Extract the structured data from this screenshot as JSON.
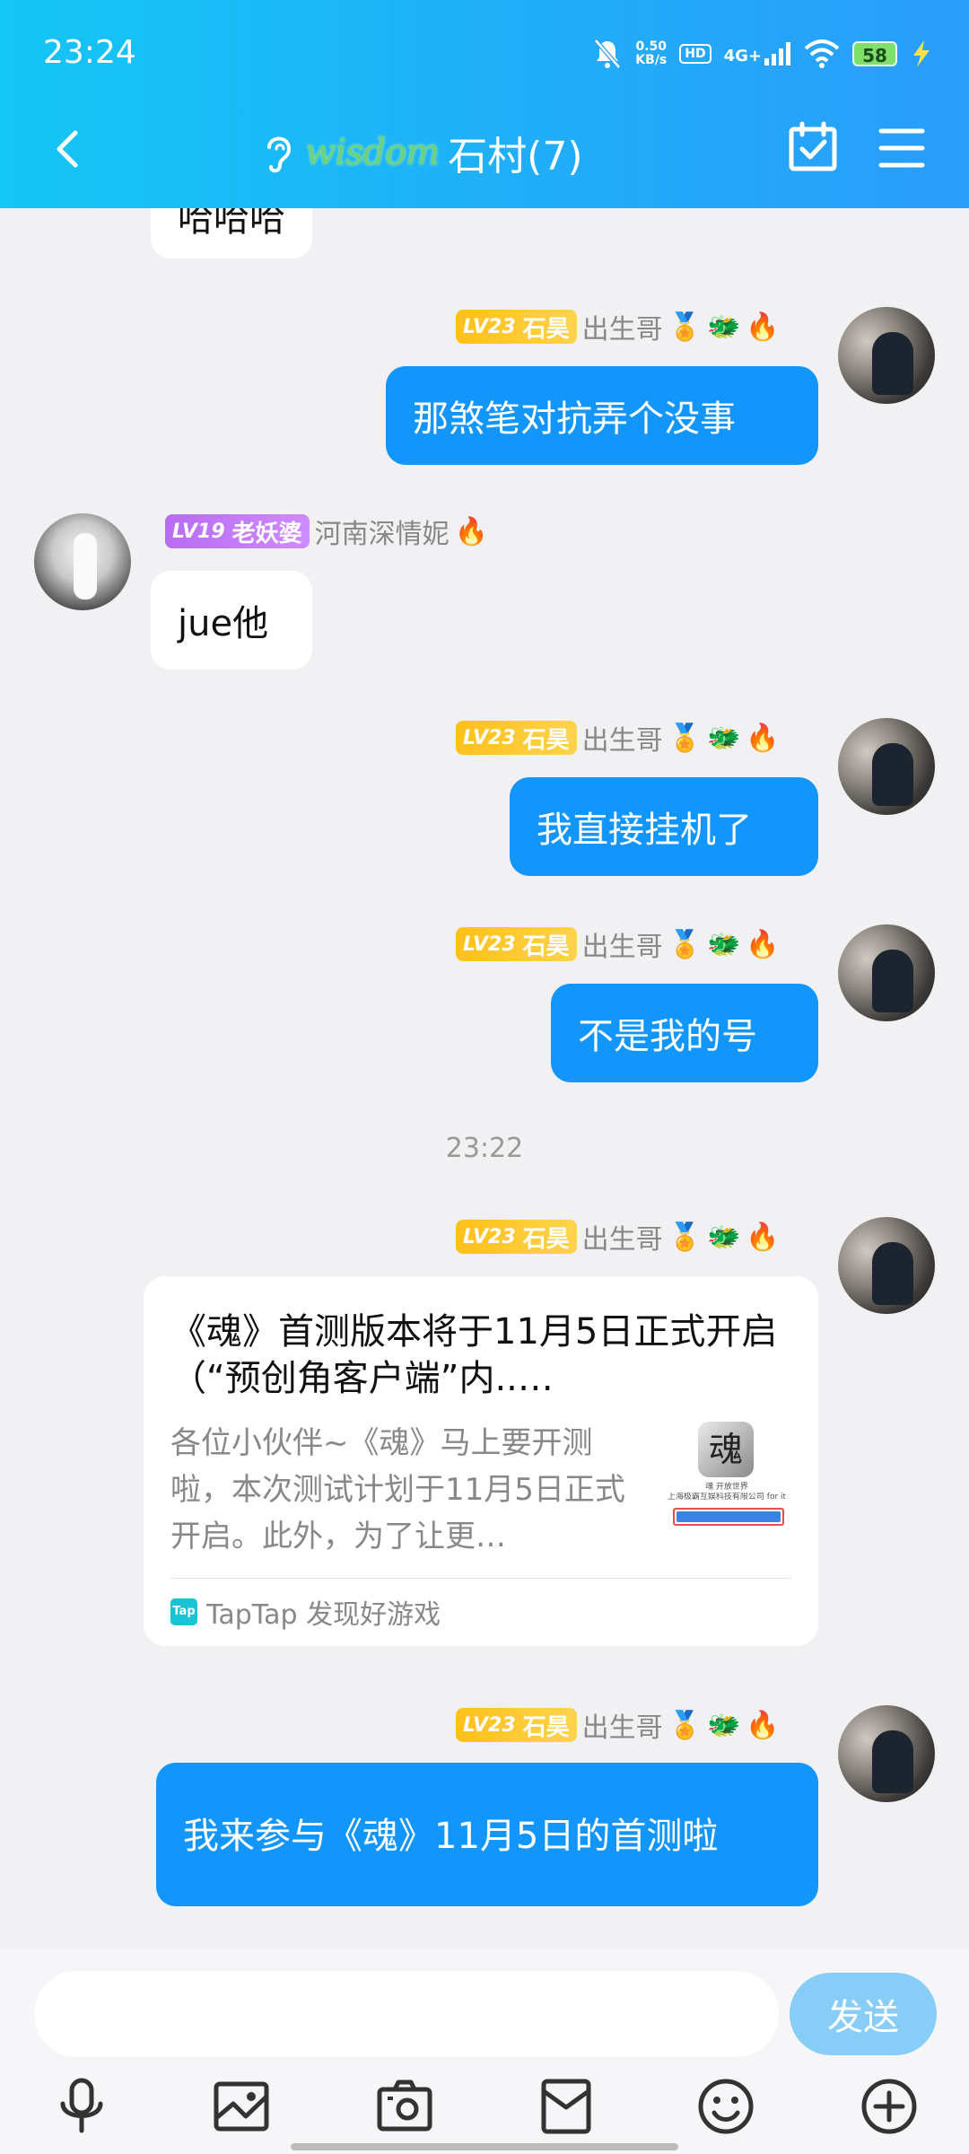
{
  "status_bar": {
    "time": "23:24",
    "net_speed_value": "0.50",
    "net_speed_unit": "KB/s",
    "hd_label": "HD",
    "network_label": "4G+",
    "battery_level": "58"
  },
  "header": {
    "wisdom_text": "wisdom",
    "group_title": "石村(7)"
  },
  "members": {
    "me": {
      "level": "LV23",
      "title": "石昊",
      "nick": "出生哥"
    },
    "other": {
      "level": "LV19",
      "title": "老妖婆",
      "nick": "河南深情妮"
    }
  },
  "messages": [
    {
      "text": "哈哈哈"
    },
    {
      "text": "那煞笔对抗弄个没事"
    },
    {
      "text": "jue他"
    },
    {
      "text": "我直接挂机了"
    },
    {
      "text": "不是我的号"
    },
    {
      "text": "我来参与《魂》11月5日的首测啦"
    }
  ],
  "timestamp": "23:22",
  "share_card": {
    "title": "《魂》首测版本将于11月5日正式开启（“预创角客户端”内..…",
    "description": "各位小伙伴~《魂》马上要开测啦，本次测试计划于11月5日正式开启。此外，为了让更…",
    "source": "TapTap 发现好游戏",
    "source_logo": "Tap",
    "thumb_glyph": "魂",
    "thumb_text1": "魂 开放世界",
    "thumb_text2": "上海极霸互娱科技有限公司 for it"
  },
  "input": {
    "placeholder": "",
    "send_label": "发送"
  },
  "colors": {
    "header_start": "#14c6f4",
    "header_end": "#2a9dfb",
    "my_bubble": "#1296fb",
    "send_button": "#88cdf8",
    "level_gold": "#ffc01a",
    "level_purple": "#b86cf2"
  }
}
